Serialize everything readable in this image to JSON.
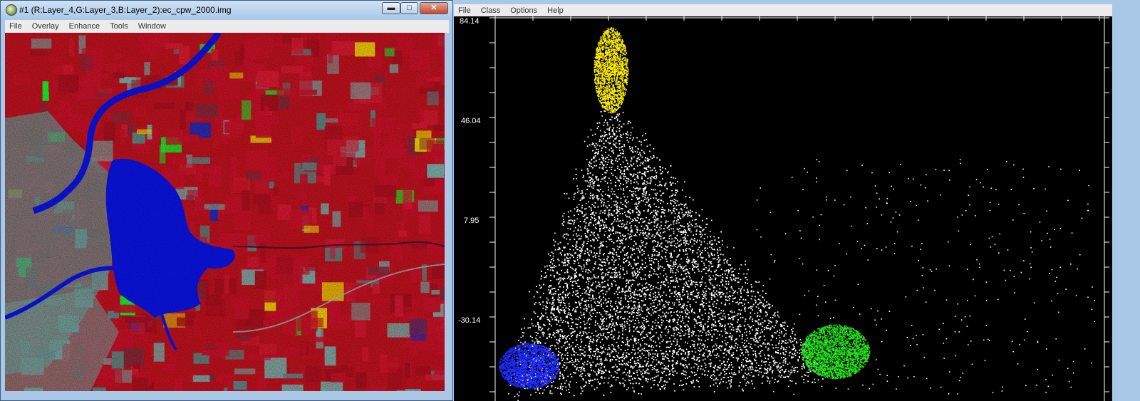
{
  "image_window": {
    "title": "#1 (R:Layer_4,G:Layer_3,B:Layer_2):ec_cpw_2000.img",
    "window_buttons": {
      "minimize": "▬",
      "maximize": "□",
      "close": "✕"
    },
    "menu": [
      "File",
      "Overlay",
      "Enhance",
      "Tools",
      "Window"
    ],
    "image_colors": {
      "vegetation": "#d4112a",
      "water": "#0a14f0",
      "bare_soil": "#7fb7b0",
      "class_green": "#19ff2a",
      "class_yellow": "#ffe600"
    }
  },
  "scatter_window": {
    "menu": [
      "File",
      "Class",
      "Options",
      "Help"
    ],
    "y_tick_labels": [
      "84.14",
      "46.04",
      "7.95",
      "-30.14"
    ],
    "class_colors": {
      "unclassified": "#ffffff",
      "class_1": "#ffee00",
      "class_2": "#1f2bff",
      "class_3": "#22e51a"
    }
  }
}
